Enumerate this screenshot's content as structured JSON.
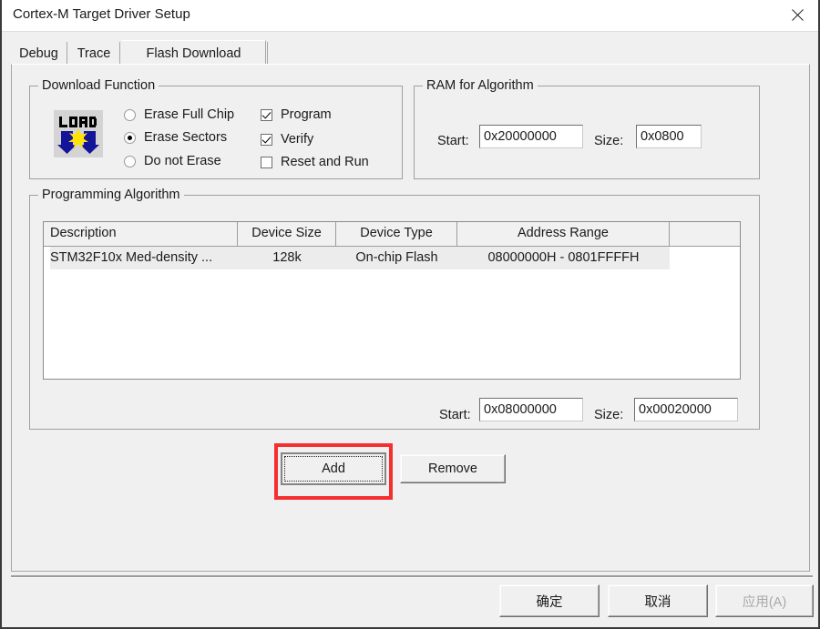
{
  "window": {
    "title": "Cortex-M Target Driver Setup",
    "close_icon": "close-icon"
  },
  "tabs": [
    {
      "label": "Debug",
      "active": false
    },
    {
      "label": "Trace",
      "active": false
    },
    {
      "label": "Flash Download",
      "active": true
    }
  ],
  "download_function": {
    "legend": "Download Function",
    "icon": "load-icon",
    "radios": [
      {
        "label": "Erase Full Chip",
        "checked": false
      },
      {
        "label": "Erase Sectors",
        "checked": true
      },
      {
        "label": "Do not Erase",
        "checked": false
      }
    ],
    "checkboxes": [
      {
        "label": "Program",
        "checked": true
      },
      {
        "label": "Verify",
        "checked": true
      },
      {
        "label": "Reset and Run",
        "checked": false
      }
    ]
  },
  "ram_for_algorithm": {
    "legend": "RAM for Algorithm",
    "start_label": "Start:",
    "start_value": "0x20000000",
    "size_label": "Size:",
    "size_value": "0x0800"
  },
  "programming_algorithm": {
    "legend": "Programming Algorithm",
    "columns": [
      "Description",
      "Device Size",
      "Device Type",
      "Address Range",
      ""
    ],
    "rows": [
      {
        "description": "STM32F10x Med-density ...",
        "device_size": "128k",
        "device_type": "On-chip Flash",
        "address_range": "08000000H - 0801FFFFH",
        "extra": "",
        "selected": true
      }
    ],
    "start_label": "Start:",
    "start_value": "0x08000000",
    "size_label": "Size:",
    "size_value": "0x00020000"
  },
  "actions": {
    "add_label": "Add",
    "remove_label": "Remove",
    "add_focused": true,
    "add_highlight_color": "#f52f2f"
  },
  "footer": {
    "ok_label": "确定",
    "cancel_label": "取消",
    "apply_label": "应用(A)",
    "apply_disabled": true
  }
}
